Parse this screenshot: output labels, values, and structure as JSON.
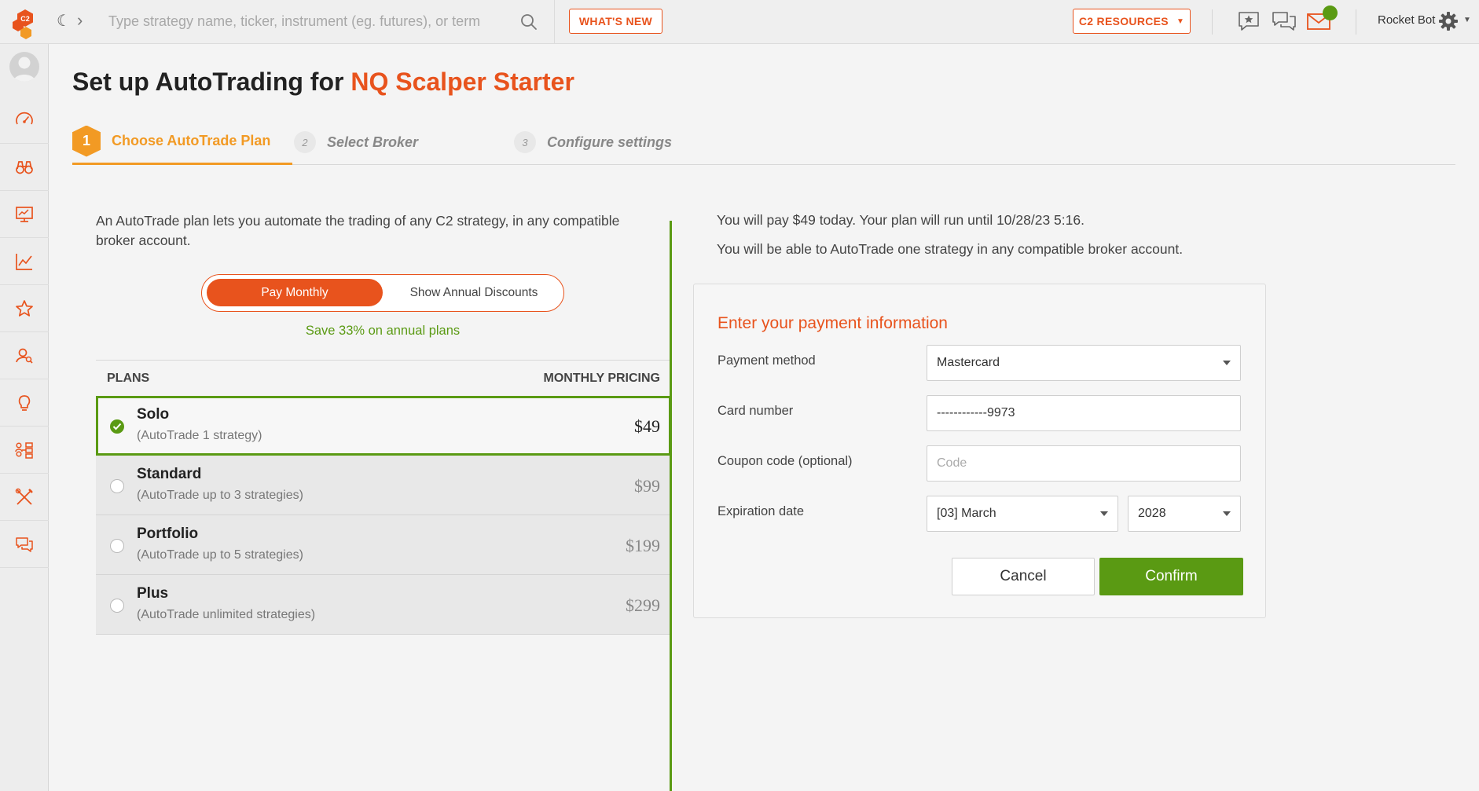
{
  "header": {
    "search_placeholder": "Type strategy name, ticker, instrument (eg. futures), or term",
    "whats_new_label": "WHAT'S NEW",
    "resources_label": "C2 RESOURCES",
    "user_name": "Rocket Bot",
    "logo_text": "C2"
  },
  "sidebar": {
    "items": [
      {
        "icon": "speedometer-icon"
      },
      {
        "icon": "binoculars-icon"
      },
      {
        "icon": "monitor-chart-icon"
      },
      {
        "icon": "line-chart-icon"
      },
      {
        "icon": "star-icon"
      },
      {
        "icon": "user-search-icon"
      },
      {
        "icon": "lightbulb-icon"
      },
      {
        "icon": "people-network-icon"
      },
      {
        "icon": "tools-icon"
      },
      {
        "icon": "chat-icon"
      }
    ]
  },
  "page": {
    "title_prefix": "Set up AutoTrading for ",
    "title_strategy": "NQ Scalper Starter"
  },
  "steps": [
    {
      "number": "1",
      "label": "Choose AutoTrade Plan",
      "active": true
    },
    {
      "number": "2",
      "label": "Select Broker",
      "active": false
    },
    {
      "number": "3",
      "label": "Configure settings",
      "active": false
    }
  ],
  "plans_section": {
    "intro": "An AutoTrade plan lets you automate the trading of any C2 strategy, in any compatible broker account.",
    "toggle_monthly": "Pay Monthly",
    "toggle_annual": "Show Annual Discounts",
    "save_note": "Save 33% on annual plans",
    "col_plans": "PLANS",
    "col_pricing": "MONTHLY PRICING",
    "rows": [
      {
        "name": "Solo",
        "desc": "(AutoTrade 1 strategy)",
        "price": "$49",
        "selected": true
      },
      {
        "name": "Standard",
        "desc": "(AutoTrade up to 3 strategies)",
        "price": "$99",
        "selected": false
      },
      {
        "name": "Portfolio",
        "desc": "(AutoTrade up to 5 strategies)",
        "price": "$199",
        "selected": false
      },
      {
        "name": "Plus",
        "desc": "(AutoTrade unlimited strategies)",
        "price": "$299",
        "selected": false
      }
    ]
  },
  "summary": {
    "line1": "You will pay $49 today. Your plan will run until 10/28/23 5:16.",
    "line2": "You will be able to AutoTrade one strategy in any compatible broker account."
  },
  "payment": {
    "title": "Enter your payment information",
    "method_label": "Payment method",
    "method_value": "Mastercard",
    "card_label": "Card number",
    "card_value": "------------9973",
    "coupon_label": "Coupon code (optional)",
    "coupon_placeholder": "Code",
    "exp_label": "Expiration date",
    "exp_month": "[03] March",
    "exp_year": "2028",
    "cancel_label": "Cancel",
    "confirm_label": "Confirm"
  },
  "colors": {
    "accent": "#e8531d",
    "step_orange": "#f29a24",
    "green": "#5a9a13"
  }
}
